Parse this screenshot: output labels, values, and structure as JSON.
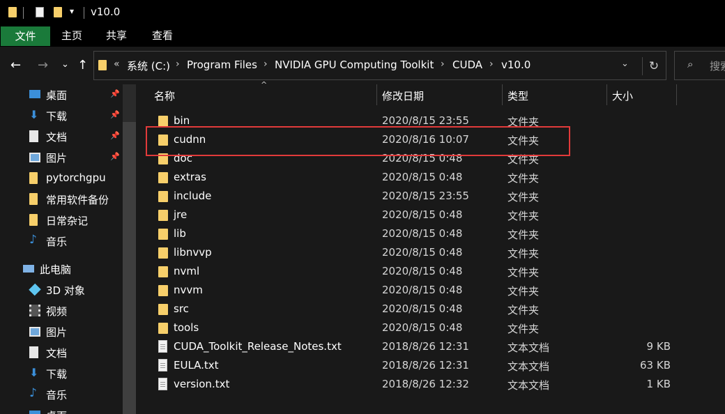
{
  "titlebar": {
    "title": "v10.0"
  },
  "ribbon": {
    "tabs": [
      "文件",
      "主页",
      "共享",
      "查看"
    ]
  },
  "address": {
    "overflow": "«",
    "crumbs": [
      "系统 (C:)",
      "Program Files",
      "NVIDIA GPU Computing Toolkit",
      "CUDA",
      "v10.0"
    ],
    "search_placeholder": "搜索"
  },
  "sidebar": {
    "quick": [
      {
        "label": "桌面",
        "icon": "desktop-icon"
      },
      {
        "label": "下载",
        "icon": "download-icon"
      },
      {
        "label": "文档",
        "icon": "document-icon"
      },
      {
        "label": "图片",
        "icon": "picture-icon"
      },
      {
        "label": "pytorchgpu",
        "icon": "folder-icon"
      },
      {
        "label": "常用软件备份",
        "icon": "folder-icon"
      },
      {
        "label": "日常杂记",
        "icon": "folder-icon"
      },
      {
        "label": "音乐",
        "icon": "music-icon"
      }
    ],
    "this_pc": "此电脑",
    "pc_items": [
      {
        "label": "3D 对象",
        "icon": "cube-icon"
      },
      {
        "label": "视频",
        "icon": "video-icon"
      },
      {
        "label": "图片",
        "icon": "picture-icon"
      },
      {
        "label": "文档",
        "icon": "document-icon"
      },
      {
        "label": "下载",
        "icon": "download-icon"
      },
      {
        "label": "音乐",
        "icon": "music-icon"
      },
      {
        "label": "桌面",
        "icon": "desktop-icon"
      }
    ]
  },
  "columns": {
    "name": "名称",
    "date": "修改日期",
    "type": "类型",
    "size": "大小"
  },
  "files": [
    {
      "name": "bin",
      "date": "2020/8/15 23:55",
      "type": "文件夹",
      "size": "",
      "kind": "folder"
    },
    {
      "name": "cudnn",
      "date": "2020/8/16 10:07",
      "type": "文件夹",
      "size": "",
      "kind": "folder"
    },
    {
      "name": "doc",
      "date": "2020/8/15 0:48",
      "type": "文件夹",
      "size": "",
      "kind": "folder"
    },
    {
      "name": "extras",
      "date": "2020/8/15 0:48",
      "type": "文件夹",
      "size": "",
      "kind": "folder"
    },
    {
      "name": "include",
      "date": "2020/8/15 23:55",
      "type": "文件夹",
      "size": "",
      "kind": "folder"
    },
    {
      "name": "jre",
      "date": "2020/8/15 0:48",
      "type": "文件夹",
      "size": "",
      "kind": "folder"
    },
    {
      "name": "lib",
      "date": "2020/8/15 0:48",
      "type": "文件夹",
      "size": "",
      "kind": "folder"
    },
    {
      "name": "libnvvp",
      "date": "2020/8/15 0:48",
      "type": "文件夹",
      "size": "",
      "kind": "folder"
    },
    {
      "name": "nvml",
      "date": "2020/8/15 0:48",
      "type": "文件夹",
      "size": "",
      "kind": "folder"
    },
    {
      "name": "nvvm",
      "date": "2020/8/15 0:48",
      "type": "文件夹",
      "size": "",
      "kind": "folder"
    },
    {
      "name": "src",
      "date": "2020/8/15 0:48",
      "type": "文件夹",
      "size": "",
      "kind": "folder"
    },
    {
      "name": "tools",
      "date": "2020/8/15 0:48",
      "type": "文件夹",
      "size": "",
      "kind": "folder"
    },
    {
      "name": "CUDA_Toolkit_Release_Notes.txt",
      "date": "2018/8/26 12:31",
      "type": "文本文档",
      "size": "9 KB",
      "kind": "text"
    },
    {
      "name": "EULA.txt",
      "date": "2018/8/26 12:31",
      "type": "文本文档",
      "size": "63 KB",
      "kind": "text"
    },
    {
      "name": "version.txt",
      "date": "2018/8/26 12:32",
      "type": "文本文档",
      "size": "1 KB",
      "kind": "text"
    }
  ],
  "colors": {
    "accent_tab": "#1a7a3a",
    "folder": "#f7cf6a",
    "highlight": "#e23a3a"
  }
}
